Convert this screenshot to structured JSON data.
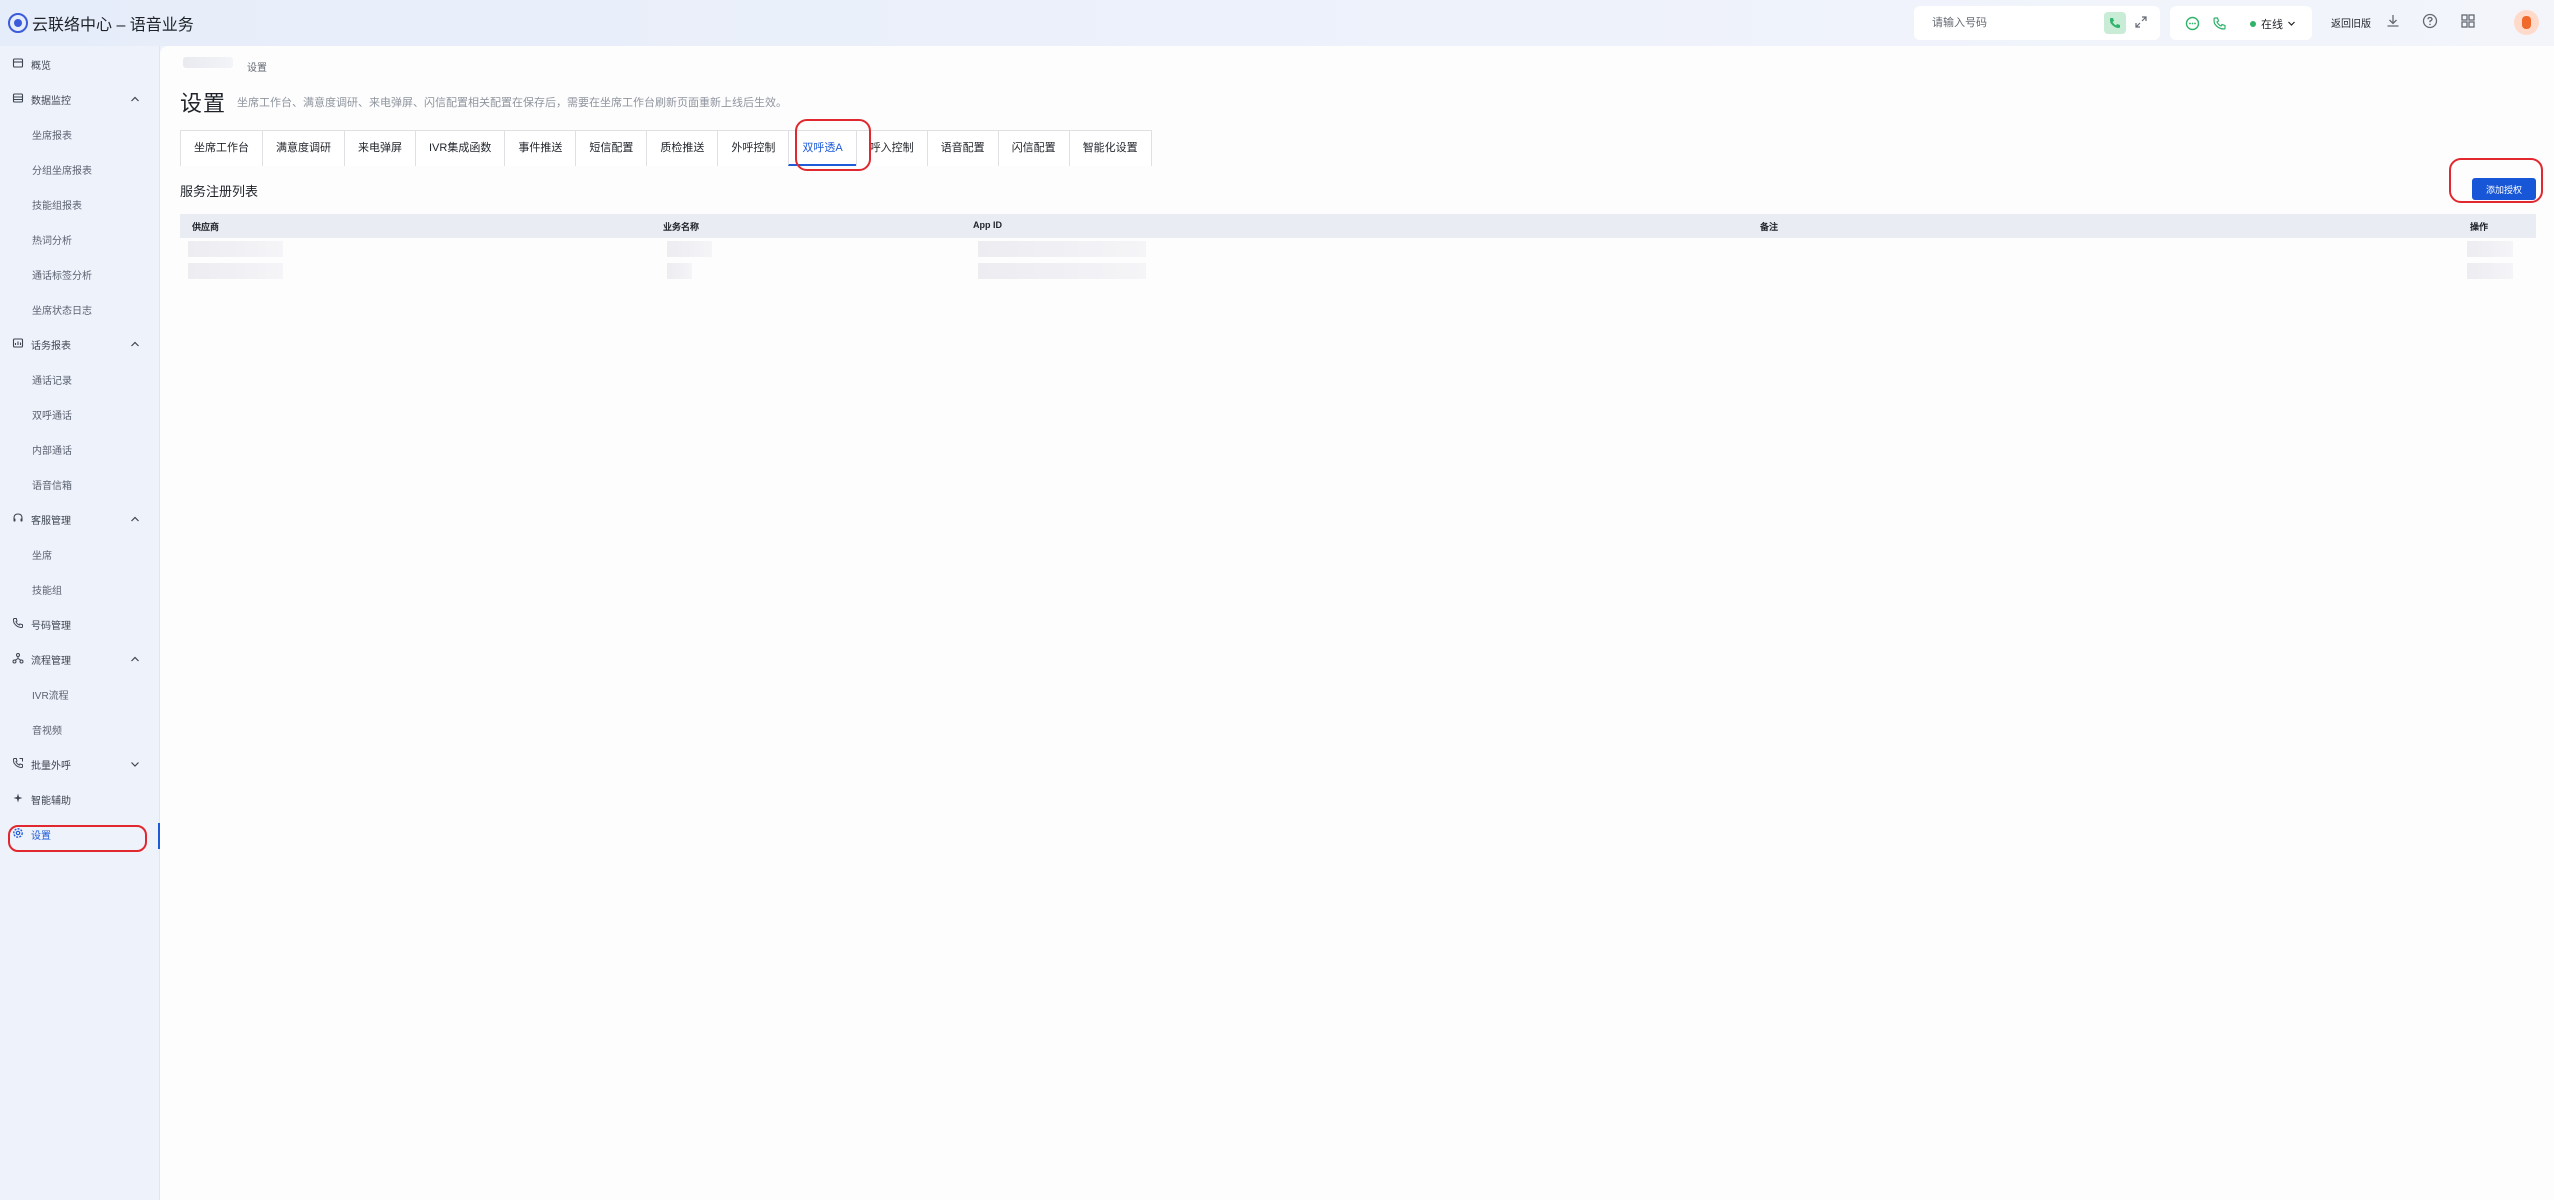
{
  "header": {
    "app_title": "云联络中心 – 语音业务",
    "dial_placeholder": "请输入号码",
    "status": "在线",
    "back_to_old": "返回旧版"
  },
  "sidebar": {
    "items": [
      {
        "label": "概览",
        "icon": "overview-icon"
      },
      {
        "label": "数据监控",
        "icon": "monitor-icon",
        "expanded": true
      },
      {
        "label": "坐席报表"
      },
      {
        "label": "分组坐席报表"
      },
      {
        "label": "技能组报表"
      },
      {
        "label": "热词分析"
      },
      {
        "label": "通话标签分析"
      },
      {
        "label": "坐席状态日志"
      },
      {
        "label": "话务报表",
        "icon": "report-icon",
        "expanded": true
      },
      {
        "label": "通话记录"
      },
      {
        "label": "双呼通话"
      },
      {
        "label": "内部通话"
      },
      {
        "label": "语音信箱"
      },
      {
        "label": "客服管理",
        "icon": "headset-icon",
        "expanded": true
      },
      {
        "label": "坐席"
      },
      {
        "label": "技能组"
      },
      {
        "label": "号码管理",
        "icon": "phone-icon"
      },
      {
        "label": "流程管理",
        "icon": "flow-icon",
        "expanded": true
      },
      {
        "label": "IVR流程"
      },
      {
        "label": "音视频"
      },
      {
        "label": "批量外呼",
        "icon": "outbound-icon",
        "expanded": false
      },
      {
        "label": "智能辅助",
        "icon": "ai-assist-icon"
      },
      {
        "label": "设置",
        "icon": "settings-icon",
        "active": true
      }
    ]
  },
  "main": {
    "breadcrumb_current": "设置",
    "title": "设置",
    "description": "坐席工作台、满意度调研、来电弹屏、闪信配置相关配置在保存后，需要在坐席工作台刷新页面重新上线后生效。",
    "tabs": [
      {
        "label": "坐席工作台"
      },
      {
        "label": "满意度调研"
      },
      {
        "label": "来电弹屏"
      },
      {
        "label": "IVR集成函数"
      },
      {
        "label": "事件推送"
      },
      {
        "label": "短信配置"
      },
      {
        "label": "质检推送"
      },
      {
        "label": "外呼控制"
      },
      {
        "label": "双呼透A",
        "active": true
      },
      {
        "label": "呼入控制"
      },
      {
        "label": "语音配置"
      },
      {
        "label": "闪信配置"
      },
      {
        "label": "智能化设置"
      }
    ],
    "section_title": "服务注册列表",
    "add_button": "添加授权",
    "table": {
      "columns": [
        "供应商",
        "业务名称",
        "App ID",
        "备注",
        "操作"
      ]
    }
  }
}
